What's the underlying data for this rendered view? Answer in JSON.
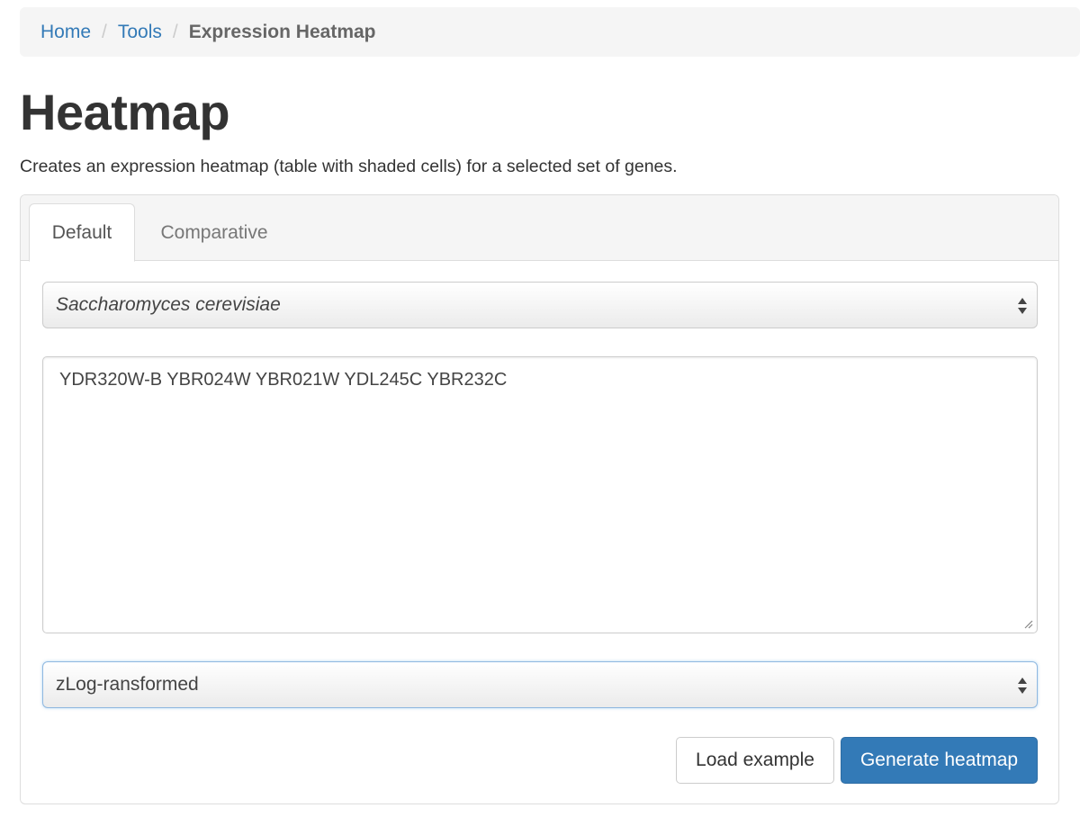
{
  "breadcrumb": {
    "items": [
      {
        "label": "Home"
      },
      {
        "label": "Tools"
      },
      {
        "label": "Expression Heatmap"
      }
    ],
    "separator": "/"
  },
  "page": {
    "title": "Heatmap",
    "description": "Creates an expression heatmap (table with shaded cells) for a selected set of genes."
  },
  "tabs": [
    {
      "label": "Default",
      "active": true
    },
    {
      "label": "Comparative",
      "active": false
    }
  ],
  "form": {
    "species_select": {
      "selected": "Saccharomyces cerevisiae"
    },
    "genes_textarea": {
      "value": "YDR320W-B YBR024W YBR021W YDL245C YBR232C"
    },
    "transform_select": {
      "selected": "zLog-ransformed"
    },
    "load_example_label": "Load example",
    "generate_label": "Generate heatmap"
  },
  "colors": {
    "link": "#337ab7",
    "primary_button": "#337ab7",
    "breadcrumb_bg": "#f5f5f5"
  },
  "icons": {
    "select_arrows": "updown-arrows-icon",
    "resize": "resize-grip-icon"
  }
}
